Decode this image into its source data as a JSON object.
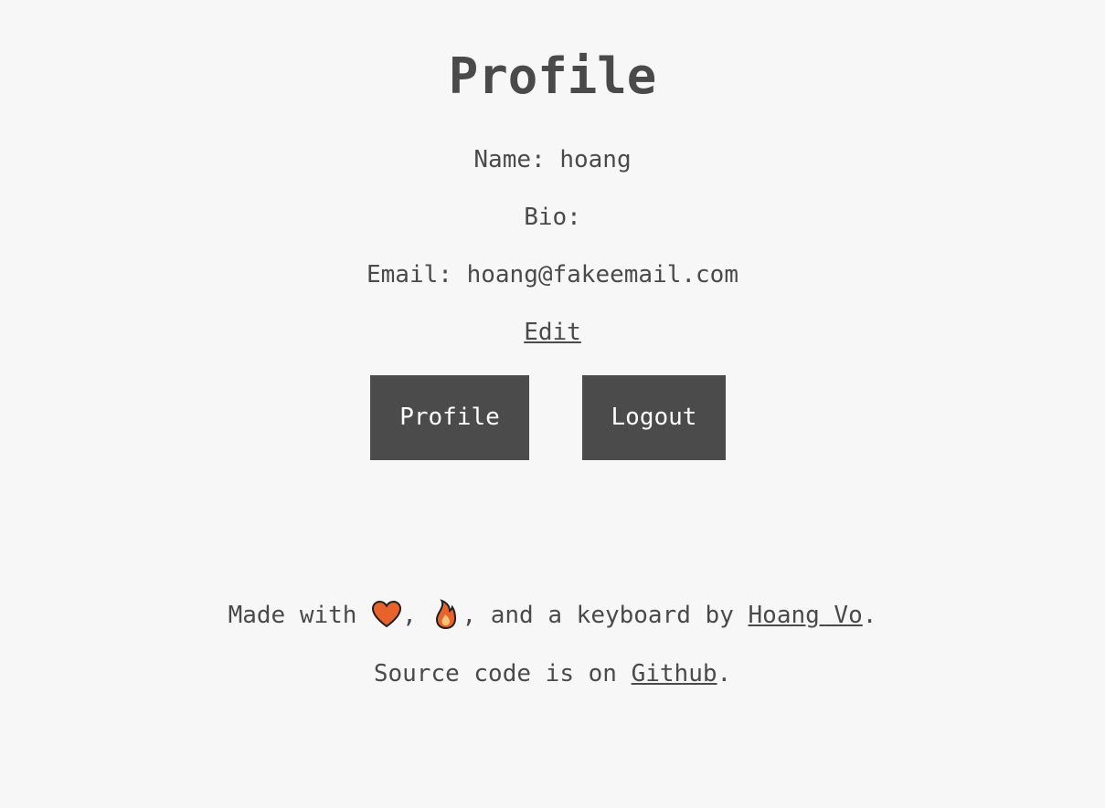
{
  "page": {
    "title": "Profile"
  },
  "profile": {
    "name_label": "Name:",
    "name_value": "hoang",
    "bio_label": "Bio:",
    "bio_value": "",
    "email_label": "Email:",
    "email_value": "hoang@fakeemail.com",
    "edit_link": "Edit"
  },
  "buttons": {
    "profile_label": "Profile",
    "logout_label": "Logout"
  },
  "footer": {
    "made_with": "Made with",
    "comma": ",",
    "and_a_keyboard_by": ", and a keyboard by",
    "author_link": "Hoang Vo",
    "period": ".",
    "source_prefix": "Source code is on",
    "github_link": "Github",
    "icons": [
      "heart-icon",
      "fire-icon"
    ]
  },
  "colors": {
    "background": "#f7f7f7",
    "text": "#4a4a4a",
    "button_bg": "#4b4b4b",
    "button_text": "#ffffff",
    "heart": "#e8622c",
    "fire": "#e8622c"
  }
}
